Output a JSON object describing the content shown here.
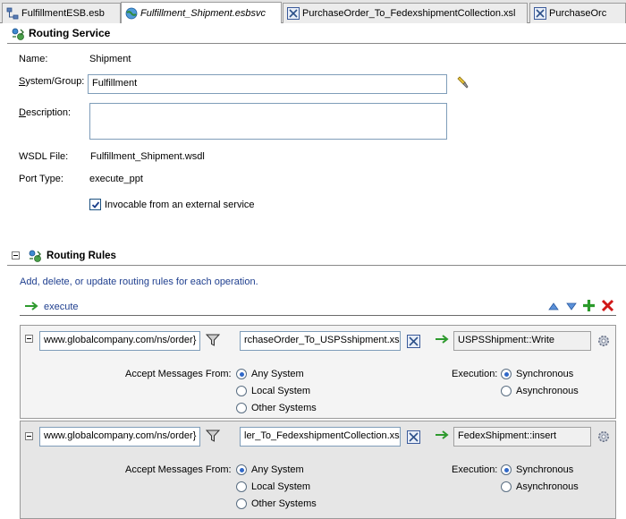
{
  "tabs": [
    {
      "label": "FulfillmentESB.esb",
      "icon": "esb-icon",
      "active": false
    },
    {
      "label": "Fulfillment_Shipment.esbsvc",
      "icon": "globe-icon",
      "active": true
    },
    {
      "label": "PurchaseOrder_To_FedexshipmentCollection.xsl",
      "icon": "xsl-icon",
      "active": false
    },
    {
      "label": "PurchaseOrc",
      "icon": "xsl-icon",
      "active": false
    }
  ],
  "routing_service": {
    "title": "Routing Service",
    "name_label": "Name:",
    "name_value": "Shipment",
    "system_label_u": "S",
    "system_label_rest": "ystem/Group:",
    "system_value": "Fulfillment",
    "description_label_u": "D",
    "description_label_rest": "escription:",
    "description_value": "",
    "wsdl_label": "WSDL File:",
    "wsdl_value": "Fulfillment_Shipment.wsdl",
    "port_label": "Port Type:",
    "port_value": "execute_ppt",
    "invocable_label": "Invocable from an external service",
    "invocable_checked": true
  },
  "routing_rules": {
    "title": "Routing Rules",
    "hint": "Add, delete, or update routing rules for each operation.",
    "operation": "execute",
    "rules": [
      {
        "namespace": "www.globalcompany.com/ns/order}",
        "transform": "rchaseOrder_To_USPSshipment.xsl",
        "target": "USPSShipment::Write",
        "accept_label": "Accept Messages From:",
        "accept_options": [
          "Any System",
          "Local System",
          "Other Systems"
        ],
        "accept_selected": "Any System",
        "execution_label": "Execution:",
        "execution_options": [
          "Synchronous",
          "Asynchronous"
        ],
        "execution_selected": "Synchronous"
      },
      {
        "namespace": "www.globalcompany.com/ns/order}",
        "transform": "ler_To_FedexshipmentCollection.xsl",
        "target": "FedexShipment::insert",
        "accept_label": "Accept Messages From:",
        "accept_options": [
          "Any System",
          "Local System",
          "Other Systems"
        ],
        "accept_selected": "Any System",
        "execution_label": "Execution:",
        "execution_options": [
          "Synchronous",
          "Asynchronous"
        ],
        "execution_selected": "Synchronous"
      }
    ]
  },
  "colors": {
    "link": "#1f3f8f",
    "rule1_bg": "#f4f4f4",
    "rule2_bg": "#e6e6e6",
    "add": "#2a9a2a",
    "delete": "#d01818"
  }
}
